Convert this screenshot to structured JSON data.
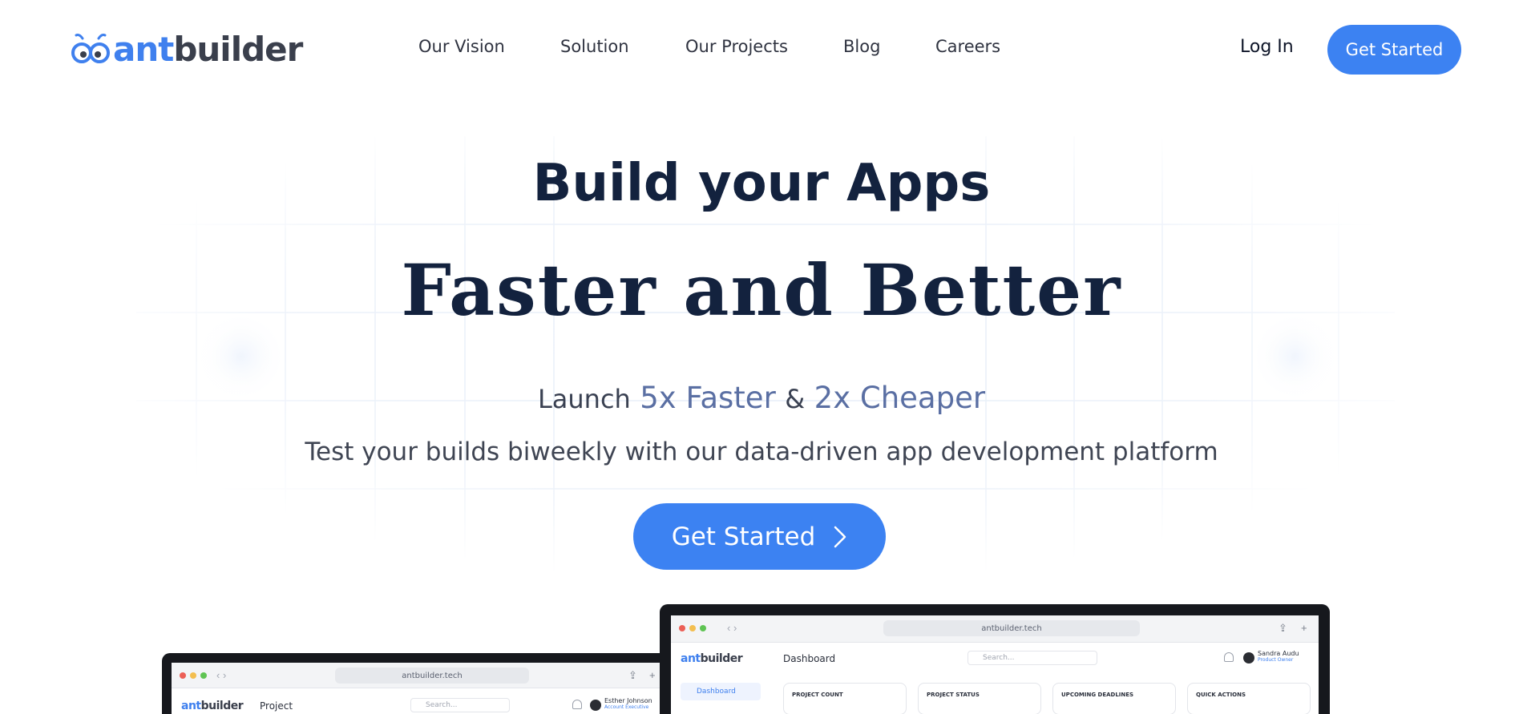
{
  "brand": {
    "name_part1": "ant",
    "name_part2": "builder",
    "accent": "#3c82f2",
    "dark": "#13223e"
  },
  "nav": {
    "links": [
      "Our Vision",
      "Solution",
      "Our Projects",
      "Blog",
      "Careers"
    ],
    "login": "Log In",
    "cta": "Get Started"
  },
  "hero": {
    "title_line1": "Build your Apps",
    "title_line2": "Faster and Better",
    "launch_prefix": "Launch",
    "launch_speed": "5x Faster",
    "launch_and": "&",
    "launch_cost": "2x Cheaper",
    "subtitle": "Test your builds biweekly with our data-driven app development platform",
    "cta": "Get Started",
    "cta_icon": "chevron-right-icon"
  },
  "mockups": {
    "back": {
      "url": "antbuilder.tech",
      "page_title": "Project",
      "search_placeholder": "Search...",
      "user_name": "Esther Johnson",
      "user_role": "Account Executive"
    },
    "front": {
      "url": "antbuilder.tech",
      "page_title": "Dashboard",
      "search_placeholder": "Search...",
      "user_name": "Sandra Audu",
      "user_role": "Product Owner",
      "sidebar_active": "Dashboard",
      "cards": [
        "PROJECT COUNT",
        "PROJECT STATUS",
        "UPCOMING DEADLINES",
        "QUICK ACTIONS"
      ]
    }
  }
}
